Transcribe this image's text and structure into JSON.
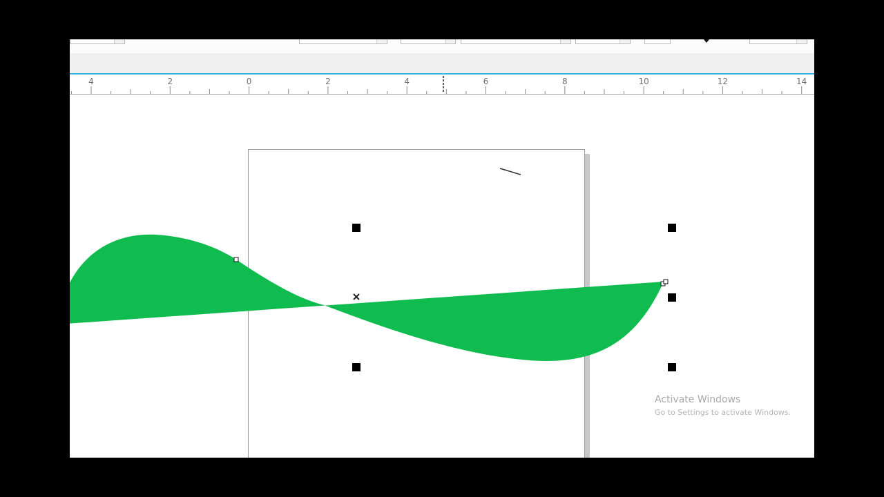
{
  "ruler": {
    "labels": [
      "4",
      "2",
      "0",
      "2",
      "4",
      "6",
      "8",
      "10",
      "12",
      "14"
    ]
  },
  "colors": {
    "shape_fill": "#10bb4f",
    "ruler_accent": "#3fb3e6",
    "handle": "#000000"
  },
  "icons": {
    "center_marker": "x-mark-icon",
    "node": "node-square-icon"
  },
  "watermark": {
    "title": "Activate Windows",
    "subtitle": "Go to Settings to activate Windows."
  }
}
